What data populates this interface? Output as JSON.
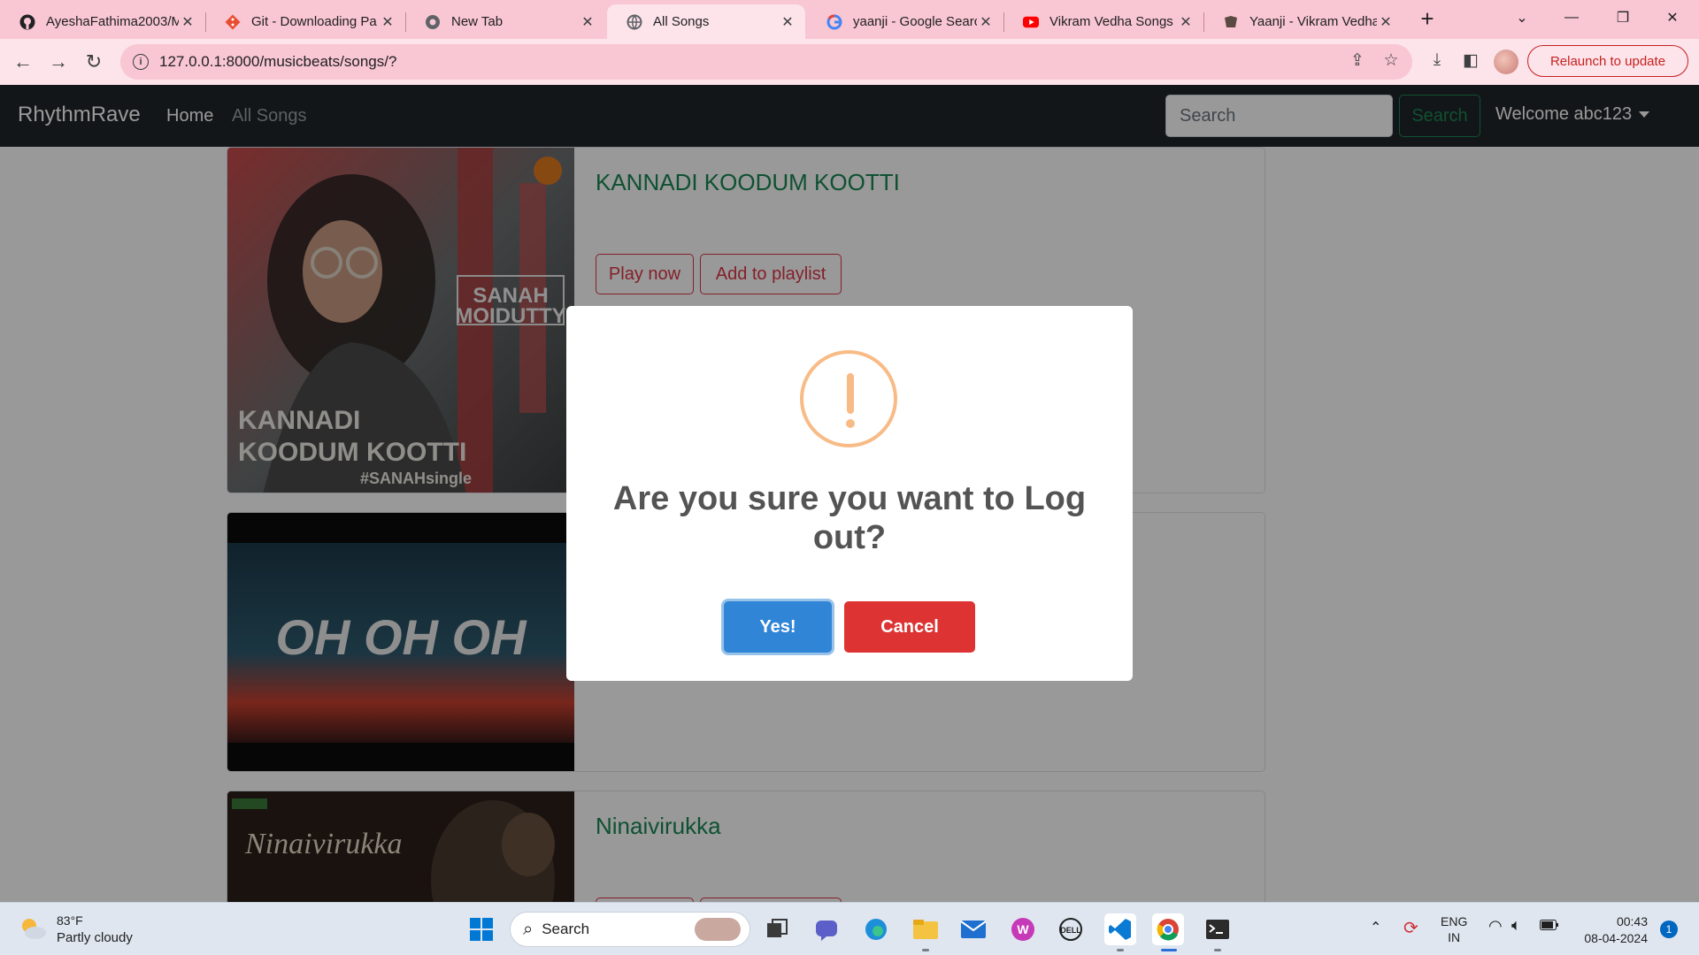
{
  "browser": {
    "tabs": [
      {
        "title": "AyeshaFathima2003/M",
        "icon": "github-icon"
      },
      {
        "title": "Git - Downloading Pa",
        "icon": "git-icon"
      },
      {
        "title": "New Tab",
        "icon": "chrome-icon"
      },
      {
        "title": "All Songs",
        "icon": "globe-icon",
        "active": true
      },
      {
        "title": "yaanji - Google Searc",
        "icon": "google-icon"
      },
      {
        "title": "Vikram Vedha Songs |",
        "icon": "youtube-icon"
      },
      {
        "title": "Yaanji - Vikram Vedha",
        "icon": "site-icon"
      }
    ],
    "url": "127.0.0.1:8000/musicbeats/songs/?",
    "relaunch_label": "Relaunch to update"
  },
  "app": {
    "brand": "RhythmRave",
    "nav": {
      "home": "Home",
      "all_songs": "All Songs"
    },
    "search": {
      "placeholder": "Search",
      "button": "Search"
    },
    "welcome": "Welcome abc123",
    "colors": {
      "navbar": "#212529",
      "accent_green": "#198754",
      "danger": "#dc3545"
    }
  },
  "songs": [
    {
      "title": "KANNADI KOODUM KOOTTI",
      "play": "Play now",
      "add": "Add to playlist",
      "art_text": [
        "KANNADI",
        "KOODUM KOOTTI",
        "#SANAHsingle",
        "SANAH",
        "MOIDUTTY"
      ]
    },
    {
      "title": "",
      "art_text": [
        "OH OH OH"
      ]
    },
    {
      "title": "Ninaivirukka",
      "art_text": [
        "Ninaivirukka"
      ]
    }
  ],
  "modal": {
    "title": "Are you sure you want to Log out?",
    "confirm": "Yes!",
    "cancel": "Cancel",
    "icon": "warning-icon",
    "colors": {
      "confirm": "#3085d6",
      "cancel": "#dd3333",
      "icon": "#f8bb86"
    }
  },
  "taskbar": {
    "weather_temp": "83°F",
    "weather_desc": "Partly cloudy",
    "search_label": "Search",
    "lang_top": "ENG",
    "lang_bottom": "IN",
    "time": "00:43",
    "date": "08-04-2024",
    "notification_count": "1"
  }
}
